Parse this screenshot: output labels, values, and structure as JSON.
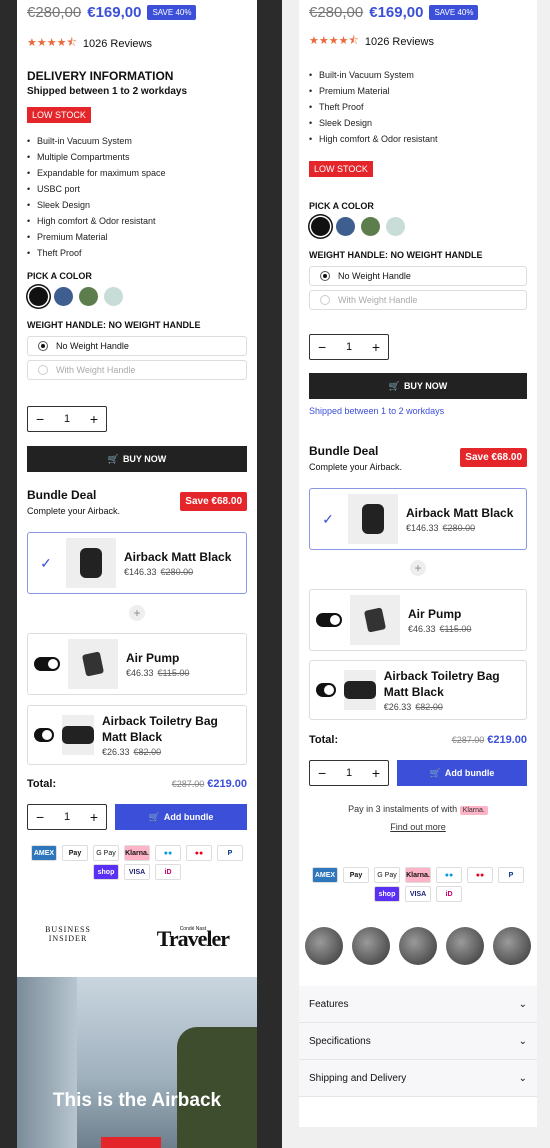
{
  "product": {
    "old_price": "€280,00",
    "new_price": "€169,00",
    "save_badge": "SAVE 40%",
    "reviews_count": "1026 Reviews",
    "rating": 4.5,
    "delivery_heading": "DELIVERY INFORMATION",
    "delivery_sub": "Shipped between 1 to 2 workdays",
    "low_stock": "LOW STOCK",
    "features": [
      "Built-in Vacuum System",
      "Multiple Compartments",
      "Expandable for maximum space",
      "USBC port",
      "Sleek Design",
      "High comfort & Odor resistant",
      "Premium Material",
      "Theft Proof"
    ],
    "features_right": [
      "Built-in Vacuum System",
      "Premium Material",
      "Theft Proof",
      "Sleek Design",
      "High comfort & Odor resistant"
    ],
    "color_label": "PICK A COLOR",
    "colors": [
      "#111111",
      "#3d5e8f",
      "#5e7d4d",
      "#c9ddd8"
    ],
    "weight_label": "WEIGHT HANDLE: NO WEIGHT HANDLE",
    "option_1": "No Weight Handle",
    "option_2": "With Weight Handle",
    "qty": "1",
    "buy_now": "BUY NOW",
    "shipped_note": "Shipped between 1 to 2 workdays"
  },
  "bundle": {
    "title": "Bundle Deal",
    "subtitle": "Complete your Airback.",
    "save": "Save €68.00",
    "items": [
      {
        "name": "Airback Matt Black",
        "price": "€146.33",
        "old": "€280.00"
      },
      {
        "name": "Air Pump",
        "price": "€46.33",
        "old": "€115.00"
      },
      {
        "name": "Airback Toiletry Bag Matt Black",
        "price": "€26.33",
        "old": "€82.00"
      }
    ],
    "total_label": "Total:",
    "total_old": "€287.00",
    "total_new": "€219.00",
    "add_label": "Add bundle"
  },
  "payments": [
    "AMEX",
    "Pay",
    "G Pay",
    "Klarna.",
    "●●",
    "●●",
    "P",
    "shop",
    "VISA",
    "iD"
  ],
  "payment_logo_text": {
    "apple": "Apple Pay",
    "google": "Google Pay"
  },
  "klarna_note": "Pay in 3 instalments of with",
  "klarna_badge": "Klarna.",
  "find_more": "Find out more",
  "press": {
    "bi": "BUSINESS INSIDER",
    "cn": "Condé Nast",
    "traveler": "Traveler"
  },
  "hero_title": "This is the Airback",
  "accordion": [
    "Features",
    "Specifications",
    "Shipping and Delivery"
  ],
  "colors": {
    "accent": "#3b4fd8",
    "red": "#e4262b",
    "dark": "#222222"
  }
}
